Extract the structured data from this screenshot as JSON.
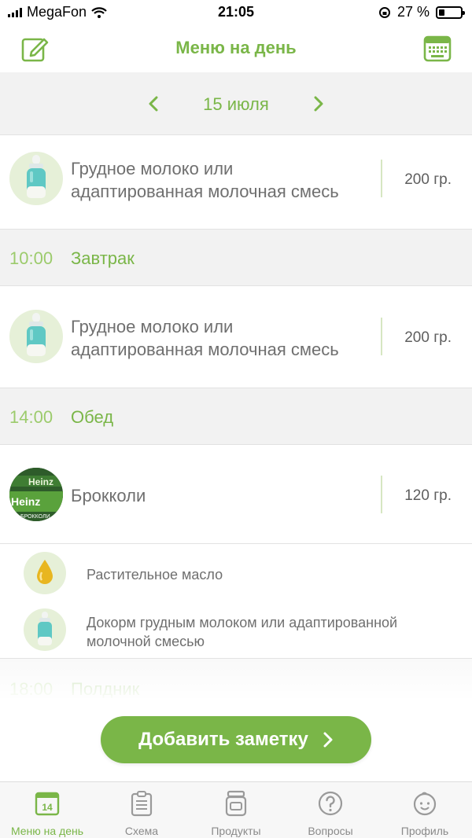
{
  "status": {
    "carrier": "MegaFon",
    "time": "21:05",
    "battery": "27 %",
    "battery_level": 0.27
  },
  "header": {
    "title": "Меню на день",
    "left_icon": "edit-icon",
    "right_icon": "keyboard-icon"
  },
  "date_nav": {
    "date": "15 июля"
  },
  "items": [
    {
      "name_line1": "Грудное молоко или",
      "name_line2": "адаптированная молочная смесь",
      "amount": "200 гр.",
      "icon": "baby-bottle-icon"
    },
    {
      "name_line1": "Грудное молоко или",
      "name_line2": "адаптированная молочная смесь",
      "amount": "200 гр.",
      "icon": "baby-bottle-icon"
    },
    {
      "name_line1": "Брокколи",
      "amount": "120 гр.",
      "icon": "broccoli-jar-image",
      "image_text": "Heinz",
      "image_subtext": "БРОККОЛИ"
    }
  ],
  "sections": [
    {
      "time": "10:00",
      "label": "Завтрак"
    },
    {
      "time": "14:00",
      "label": "Обед"
    },
    {
      "time": "18:00",
      "label": "Полдник"
    }
  ],
  "sub_items": [
    {
      "text_line1": "Растительное масло",
      "icon": "oil-drop-icon"
    },
    {
      "text_line1": "Докорм грудным молоком или адаптированной",
      "text_line2": "молочной смесью",
      "icon": "baby-bottle-icon"
    }
  ],
  "add_button": {
    "label": "Добавить заметку"
  },
  "tabs": [
    {
      "label": "Меню на день",
      "icon": "calendar-icon",
      "badge": "14",
      "active": true
    },
    {
      "label": "Схема",
      "icon": "clipboard-icon"
    },
    {
      "label": "Продукты",
      "icon": "jar-icon"
    },
    {
      "label": "Вопросы",
      "icon": "question-icon"
    },
    {
      "label": "Профиль",
      "icon": "baby-face-icon"
    }
  ],
  "colors": {
    "accent": "#7ab648",
    "accent_light": "#9ccb6c",
    "background_gray": "#f2f2f2"
  }
}
